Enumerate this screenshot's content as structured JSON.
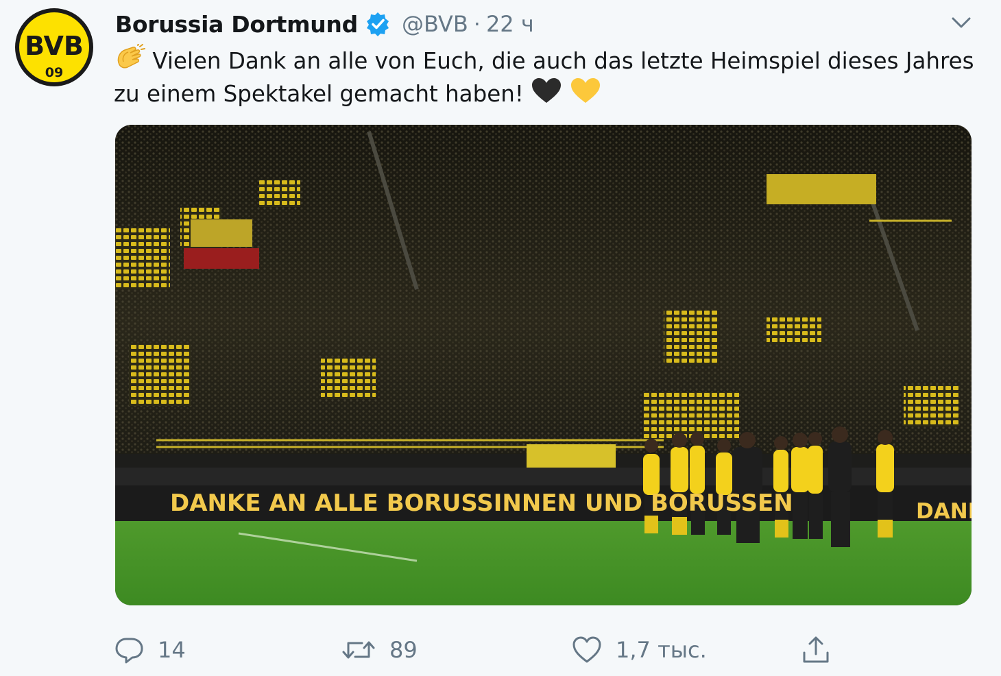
{
  "tweet": {
    "display_name": "Borussia Dortmund",
    "handle": "@BVB",
    "separator": "·",
    "time": "22 ч",
    "text_line_1": "Vielen Dank an alle von Euch, die auch das letzte Heimspiel dieses Jahres",
    "text_line_2": "zu einem Spektakel gemacht haben!",
    "media": {
      "banner_text": "DANKE AN ALLE BORUSSINNEN UND BORUSSEN",
      "banner_text_right": "DANK"
    },
    "avatar": {
      "logo_text_top": "BVB",
      "logo_text_bottom": "09"
    }
  },
  "actions": {
    "reply_count": "14",
    "retweet_count": "89",
    "like_count": "1,7 тыс."
  },
  "icons": {
    "verified": "verified-badge-icon",
    "caret": "chevron-down-icon",
    "clap": "clapping-hands-emoji",
    "heart_black": "black-heart-emoji",
    "heart_yellow": "yellow-heart-emoji",
    "reply": "reply-bubble-icon",
    "retweet": "retweet-icon",
    "like": "heart-outline-icon",
    "share": "share-upload-icon"
  },
  "colors": {
    "background": "#f5f8fa",
    "verified_blue": "#1da1f2",
    "bvb_yellow": "#fde100",
    "secondary_text": "#657786"
  }
}
